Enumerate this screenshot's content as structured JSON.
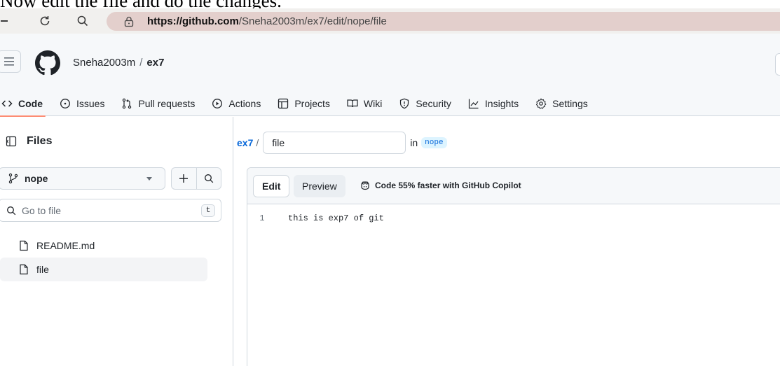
{
  "caption": "Now edit the file and do the changes.",
  "browser": {
    "url_host": "https://github.com",
    "url_path": "/Sneha2003m/ex7/edit/nope/file"
  },
  "repo": {
    "owner": "Sneha2003m",
    "separator": "/",
    "name": "ex7"
  },
  "nav_tabs": [
    {
      "label": "Code",
      "icon": "code-icon",
      "active": true
    },
    {
      "label": "Issues",
      "icon": "issue-icon"
    },
    {
      "label": "Pull requests",
      "icon": "pull-request-icon"
    },
    {
      "label": "Actions",
      "icon": "play-icon"
    },
    {
      "label": "Projects",
      "icon": "table-icon"
    },
    {
      "label": "Wiki",
      "icon": "book-icon"
    },
    {
      "label": "Security",
      "icon": "shield-icon"
    },
    {
      "label": "Insights",
      "icon": "graph-icon"
    },
    {
      "label": "Settings",
      "icon": "gear-icon"
    }
  ],
  "sidebar": {
    "title": "Files",
    "branch": "nope",
    "goto_placeholder": "Go to file",
    "goto_shortcut": "t",
    "files": [
      {
        "name": "README.md",
        "selected": false
      },
      {
        "name": "file",
        "selected": true
      }
    ]
  },
  "editor": {
    "repo_link": "ex7",
    "path_sep": "/",
    "filename": "file",
    "in_label": "in",
    "branch": "nope",
    "tab_edit": "Edit",
    "tab_preview": "Preview",
    "copilot_text": "Code 55% faster with GitHub Copilot",
    "lines": [
      {
        "number": "1",
        "text": "this is exp7 of git"
      }
    ]
  },
  "colors": {
    "accent_link": "#0969da",
    "active_tab_underline": "#fd8c73",
    "url_pill": "#e3cfcc"
  }
}
